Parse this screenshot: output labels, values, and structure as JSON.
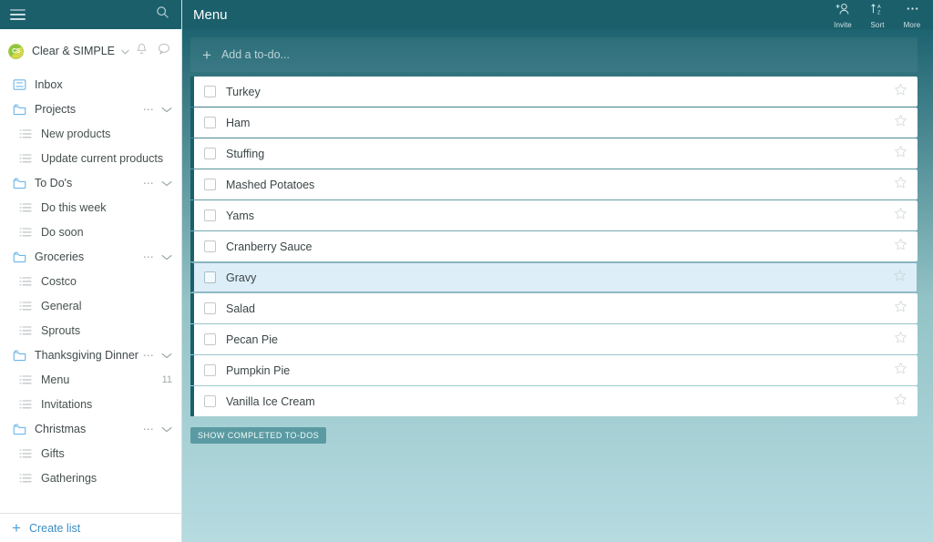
{
  "sidebar": {
    "search_icon": "search-icon",
    "menu_icon": "hamburger-icon",
    "account": {
      "avatar_initials": "CS",
      "name": "Clear & SIMPLE",
      "caret_icon": "chevron-down-icon",
      "bell_icon": "bell-icon",
      "chat_icon": "chat-bubble-icon"
    },
    "inbox": {
      "label": "Inbox",
      "icon": "inbox-icon"
    },
    "groups": [
      {
        "label": "Projects",
        "icon": "folder-icon",
        "menu_icon": "ellipsis-icon",
        "collapse_icon": "chevron-down-icon",
        "children": [
          {
            "label": "New products",
            "icon": "list-icon",
            "count": ""
          },
          {
            "label": "Update current products",
            "icon": "list-icon",
            "count": ""
          }
        ]
      },
      {
        "label": "To Do's",
        "icon": "folder-icon",
        "menu_icon": "ellipsis-icon",
        "collapse_icon": "chevron-down-icon",
        "children": [
          {
            "label": "Do this week",
            "icon": "list-icon",
            "count": ""
          },
          {
            "label": "Do soon",
            "icon": "list-icon",
            "count": ""
          }
        ]
      },
      {
        "label": "Groceries",
        "icon": "folder-icon",
        "menu_icon": "ellipsis-icon",
        "collapse_icon": "chevron-down-icon",
        "children": [
          {
            "label": "Costco",
            "icon": "list-icon",
            "count": ""
          },
          {
            "label": "General",
            "icon": "list-icon",
            "count": ""
          },
          {
            "label": "Sprouts",
            "icon": "list-icon",
            "count": ""
          }
        ]
      },
      {
        "label": "Thanksgiving Dinner",
        "icon": "folder-icon",
        "menu_icon": "ellipsis-icon",
        "collapse_icon": "chevron-down-icon",
        "children": [
          {
            "label": "Menu",
            "icon": "list-icon",
            "count": "11"
          },
          {
            "label": "Invitations",
            "icon": "list-icon",
            "count": ""
          }
        ]
      },
      {
        "label": "Christmas",
        "icon": "folder-icon",
        "menu_icon": "ellipsis-icon",
        "collapse_icon": "chevron-down-icon",
        "children": [
          {
            "label": "Gifts",
            "icon": "list-icon",
            "count": ""
          },
          {
            "label": "Gatherings",
            "icon": "list-icon",
            "count": ""
          }
        ]
      }
    ],
    "create_list": {
      "label": "Create list",
      "icon": "plus-icon"
    }
  },
  "main": {
    "title": "Menu",
    "tools": [
      {
        "label": "Invite",
        "icon": "add-person-icon"
      },
      {
        "label": "Sort",
        "icon": "sort-az-icon"
      },
      {
        "label": "More",
        "icon": "ellipsis-icon"
      }
    ],
    "add_todo": {
      "placeholder": "Add a to-do...",
      "icon": "plus-icon"
    },
    "todos": [
      {
        "label": "Turkey",
        "checked": false,
        "starred": false,
        "selected": false
      },
      {
        "label": "Ham",
        "checked": false,
        "starred": false,
        "selected": false
      },
      {
        "label": "Stuffing",
        "checked": false,
        "starred": false,
        "selected": false
      },
      {
        "label": "Mashed Potatoes",
        "checked": false,
        "starred": false,
        "selected": false
      },
      {
        "label": "Yams",
        "checked": false,
        "starred": false,
        "selected": false
      },
      {
        "label": "Cranberry Sauce",
        "checked": false,
        "starred": false,
        "selected": false
      },
      {
        "label": "Gravy",
        "checked": false,
        "starred": false,
        "selected": true
      },
      {
        "label": "Salad",
        "checked": false,
        "starred": false,
        "selected": false
      },
      {
        "label": "Pecan Pie",
        "checked": false,
        "starred": false,
        "selected": false
      },
      {
        "label": "Pumpkin Pie",
        "checked": false,
        "starred": false,
        "selected": false
      },
      {
        "label": "Vanilla Ice Cream",
        "checked": false,
        "starred": false,
        "selected": false
      }
    ],
    "show_completed": {
      "label": "SHOW COMPLETED TO-DOS"
    }
  },
  "colors": {
    "header_teal": "#1b5f6b",
    "accent_blue": "#3d8fc4",
    "selected_row": "#ddeef8",
    "completed_button": "#5b9aa2",
    "folder_icon": "#6cb6e8"
  }
}
